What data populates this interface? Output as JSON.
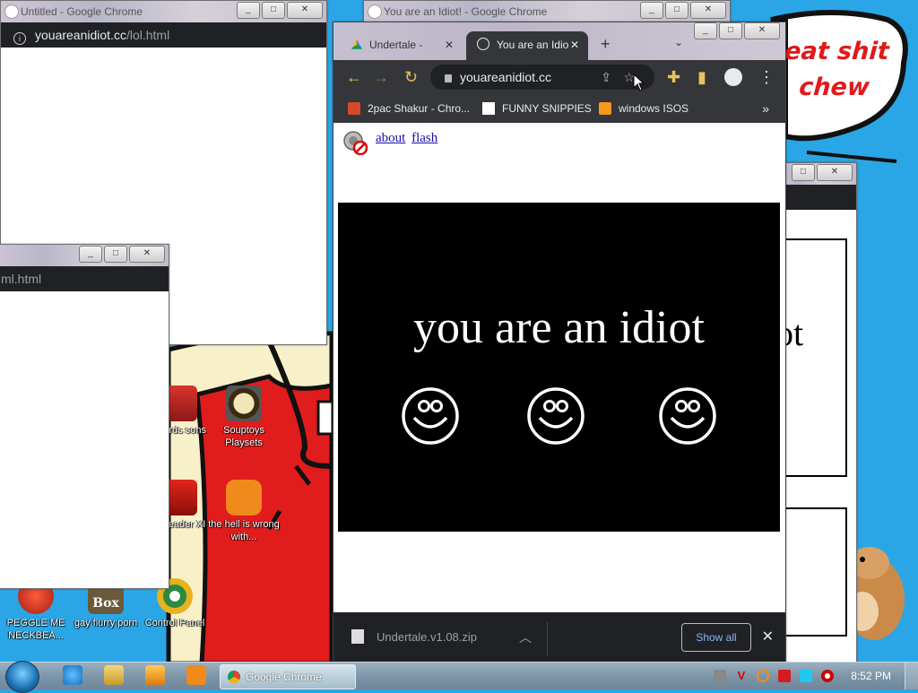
{
  "speech_bubble": {
    "line1": "eat shit",
    "line2": "chew"
  },
  "desktop_icons": [
    {
      "label": "y Birds sons"
    },
    {
      "label": "Souptoys Playsets"
    },
    {
      "label": "e Reader XI"
    },
    {
      "label": "the hell is wrong with..."
    },
    {
      "label": "PEGGLE ME NECKBEA..."
    },
    {
      "label": "gay flurry porn"
    },
    {
      "label": "Control Panel"
    }
  ],
  "box_badge": "Box",
  "window_untitled": {
    "title": "Untitled - Google Chrome",
    "url_host": "youareanidiot.cc",
    "url_path": "/lol.html"
  },
  "window_small": {
    "url_path": "ml.html"
  },
  "window_bg_top": {
    "title": "You are an Idiot! - Google Chrome"
  },
  "window_right": {
    "partial_text": "ot"
  },
  "main_window": {
    "tabs": [
      {
        "label": "Undertale - ",
        "active": false
      },
      {
        "label": "You are an Idio",
        "active": true
      }
    ],
    "new_tab": "+",
    "omnibox_url": "youareanidiot.cc",
    "bookmarks": [
      {
        "label": "2pac Shakur - Chro...",
        "icon": "music-icon"
      },
      {
        "label": "FUNNY SNIPPIES",
        "icon": "h-icon"
      },
      {
        "label": "windows ISOS",
        "icon": "ph-icon"
      }
    ],
    "bookmarks_more": "»",
    "content": {
      "links": [
        "about",
        "flash"
      ],
      "headline": "you are an idiot"
    },
    "download": {
      "filename": "Undertale.v1.08.zip",
      "show_all": "Show all"
    }
  },
  "taskbar": {
    "active_app": "Google Chrome",
    "clock": "8:52 PM"
  },
  "colors": {
    "wallpaper": "#2aa6e6",
    "accent_yellow": "#e7c45b",
    "chrome_dark": "#35363a",
    "link_blue": "#1a0dab"
  }
}
